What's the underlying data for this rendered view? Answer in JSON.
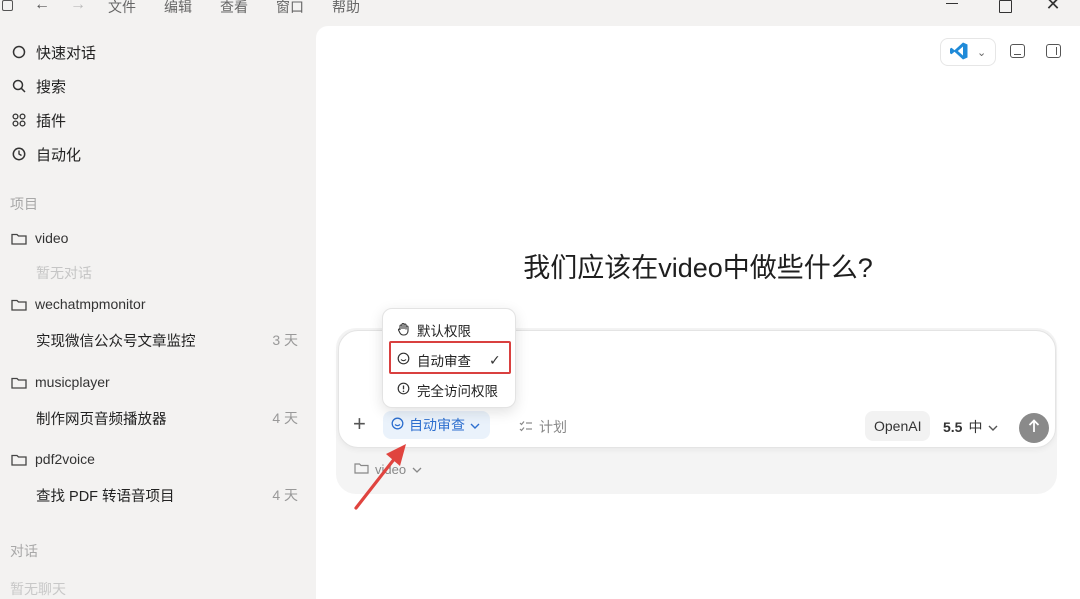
{
  "menubar": {
    "items": [
      "文件",
      "编辑",
      "查看",
      "窗口",
      "帮助"
    ]
  },
  "sidebar": {
    "nav": [
      {
        "label": "快速对话",
        "icon": "circle-icon"
      },
      {
        "label": "搜索",
        "icon": "search-icon"
      },
      {
        "label": "插件",
        "icon": "grid-icon"
      },
      {
        "label": "自动化",
        "icon": "clock-icon"
      }
    ],
    "projects_label": "项目",
    "projects": [
      {
        "name": "video",
        "empty_text": "暂无对话"
      },
      {
        "name": "wechatmpmonitor",
        "conversation": "实现微信公众号文章监控",
        "age": "3 天"
      },
      {
        "name": "musicplayer",
        "conversation": "制作网页音频播放器",
        "age": "4 天"
      },
      {
        "name": "pdf2voice",
        "conversation": "查找 PDF 转语音项目",
        "age": "4 天"
      }
    ],
    "chats_label": "对话",
    "chats_empty": "暂无聊天"
  },
  "main": {
    "headline": "我们应该在video中做些什么?",
    "composer": {
      "permission_label": "自动审查",
      "plan_label": "计划",
      "model_label": "OpenAI",
      "model_version": "5.5",
      "effort_label": "中",
      "folder_label": "video"
    },
    "permission_menu": {
      "items": [
        {
          "label": "默认权限",
          "icon": "hand-icon"
        },
        {
          "label": "自动审查",
          "icon": "smile-shield-icon",
          "selected": true
        },
        {
          "label": "完全访问权限",
          "icon": "alert-icon"
        }
      ]
    }
  },
  "colors": {
    "accent": "#2d6fcf",
    "highlight": "#d9403f",
    "sidebar_bg": "#f3f2f1"
  }
}
